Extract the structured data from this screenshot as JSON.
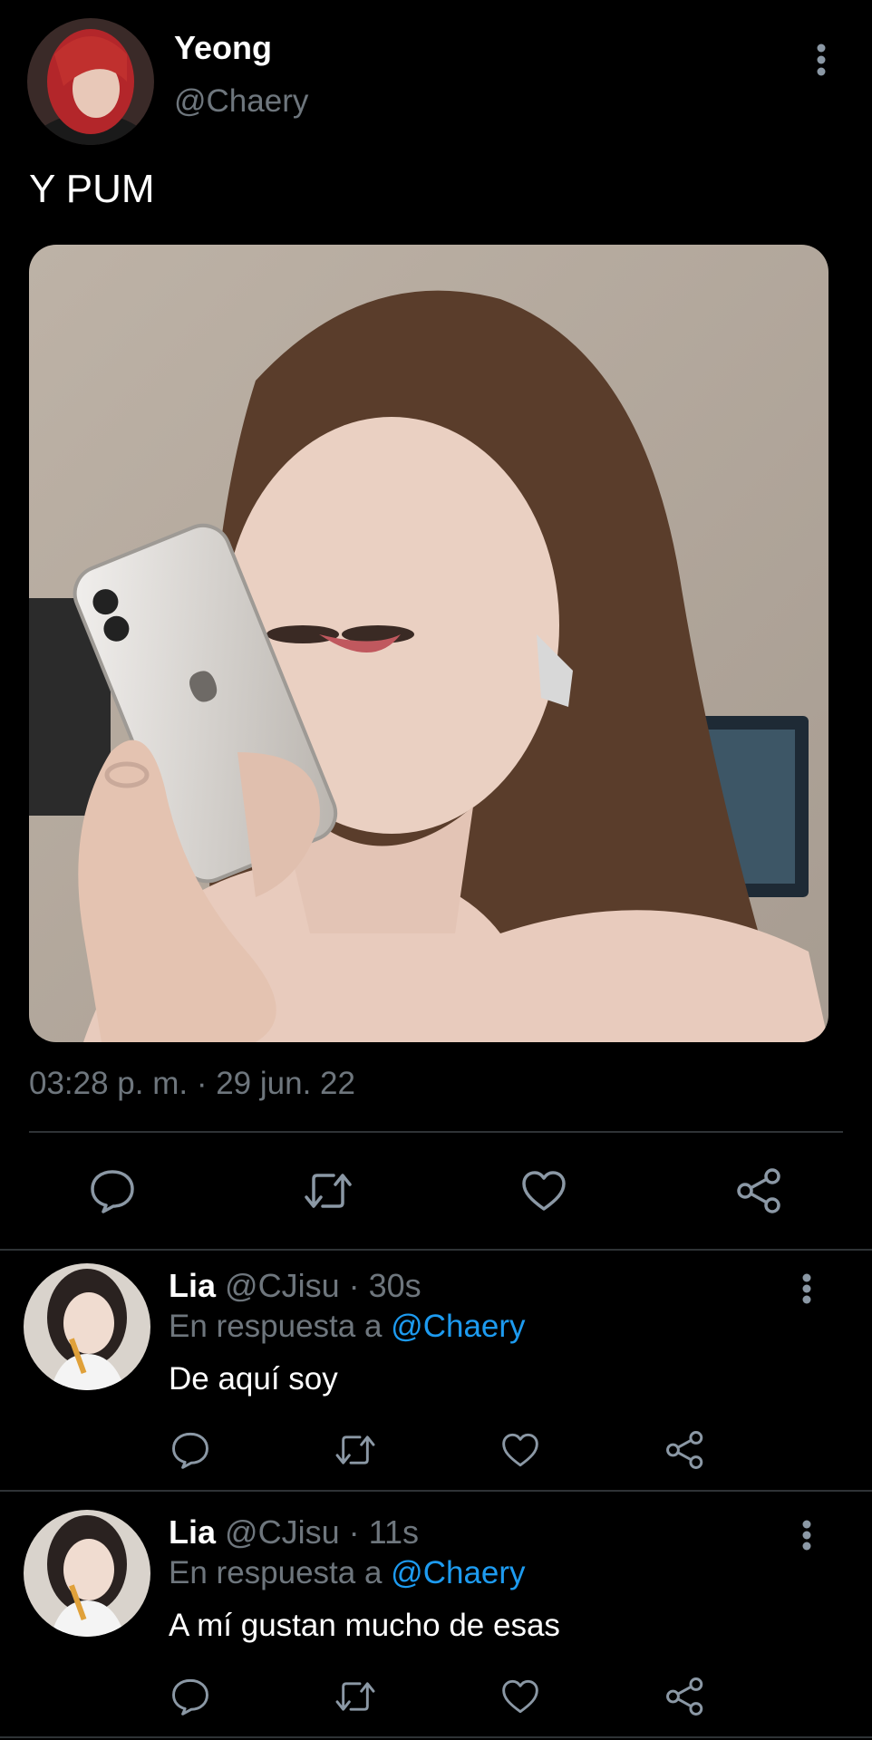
{
  "tweet": {
    "display_name": "Yeong",
    "handle": "@Chaery",
    "text": "Y PUM",
    "timestamp": "03:28 p. m. · 29 jun. 22",
    "actions": [
      "reply-icon",
      "retweet-icon",
      "like-icon",
      "share-icon"
    ]
  },
  "replies": [
    {
      "display_name": "Lia",
      "handle": "@CJisu",
      "age": "· 30s",
      "replying_prefix": "En respuesta a",
      "replying_to": "@Chaery",
      "text": "De aquí soy"
    },
    {
      "display_name": "Lia",
      "handle": "@CJisu",
      "age": "· 11s",
      "replying_prefix": "En respuesta a",
      "replying_to": "@Chaery",
      "text": "A mí gustan mucho de esas"
    }
  ],
  "colors": {
    "background": "#000000",
    "secondary_text": "#6e767d",
    "link": "#1d9bf0",
    "divider": "#2f3336"
  }
}
